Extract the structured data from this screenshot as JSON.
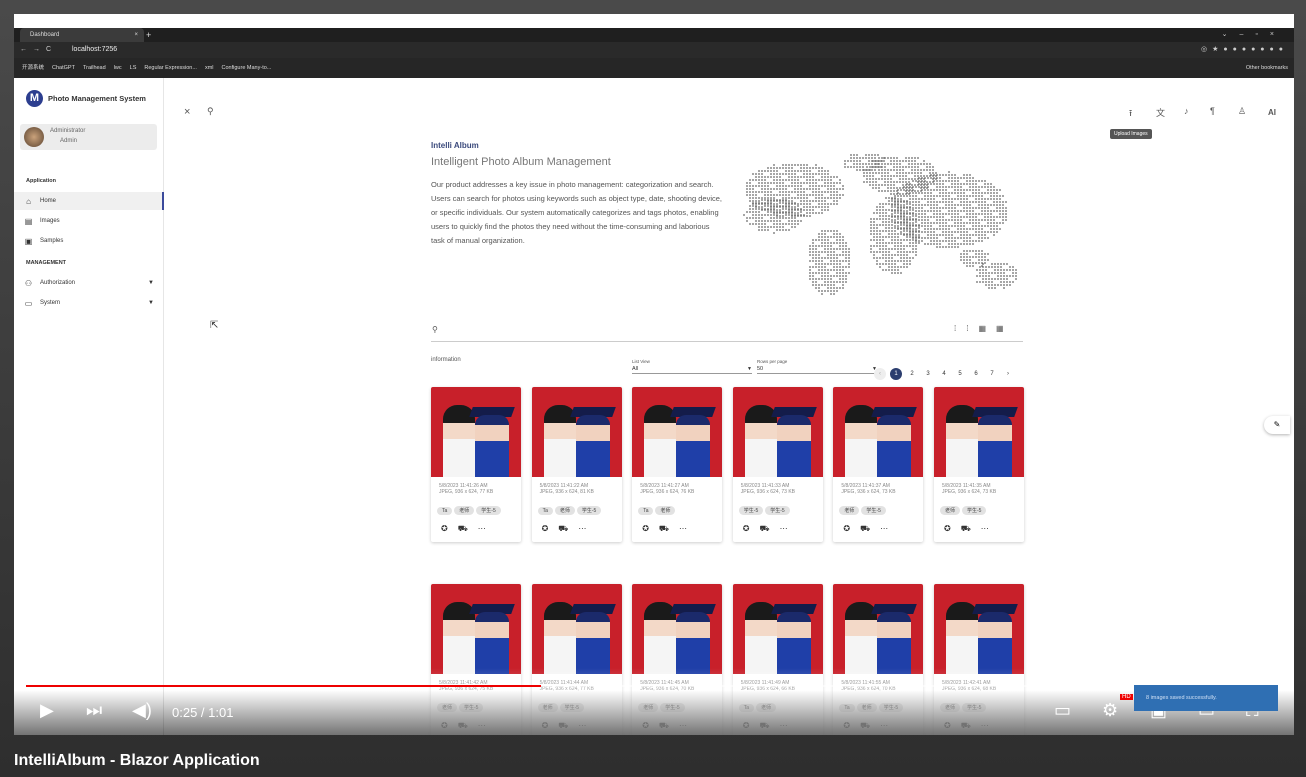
{
  "video": {
    "caption": "IntelliAlbum - Blazor Application",
    "time": "0:25 / 1:01",
    "progress": 0.41,
    "hd_badge": "HD"
  },
  "browser": {
    "tab_title": "Dashboard",
    "url": "localhost:7256",
    "bookmarks": [
      "开源系统",
      "ChatGPT",
      "Trailhead",
      "lwc",
      "LS",
      "Regular Expression...",
      "xml",
      "Configure Many-to...",
      "Other bookmarks"
    ]
  },
  "sidebar": {
    "brand": "Photo Management System",
    "user_name": "Administrator",
    "user_role": "Admin",
    "section_app": "Application",
    "items_app": [
      {
        "label": "Home",
        "icon": "home-icon"
      },
      {
        "label": "Images",
        "icon": "images-icon"
      },
      {
        "label": "Samples",
        "icon": "samples-icon"
      }
    ],
    "section_mgmt": "MANAGEMENT",
    "items_mgmt": [
      {
        "label": "Authorization",
        "icon": "authorization-icon"
      },
      {
        "label": "System",
        "icon": "system-icon"
      }
    ]
  },
  "header": {
    "tooltip": "Upload Images",
    "ai_label": "AI"
  },
  "hero": {
    "title": "Intelli Album",
    "subtitle": "Intelligent Photo Album Management",
    "description": "Our product addresses a key issue in photo management: categorization and search. Users can search for photos using keywords such as object type, date, shooting device, or specific individuals. Our system automatically categorizes and tags photos, enabling users to quickly find the photos they need without the time-consuming and laborious task of manual organization."
  },
  "search": {
    "placeholder": "",
    "info_label": "information",
    "list_view_label": "List View",
    "list_view_value": "All",
    "rows_label": "Rows per page",
    "rows_value": "50",
    "pages": [
      "1",
      "2",
      "3",
      "4",
      "5",
      "6",
      "7"
    ],
    "current_page": "1"
  },
  "cards_row1": [
    {
      "date": "5/8/2023 11:41:26 AM",
      "info": "JPEG, 936 x 624, 77 KB",
      "tags": [
        "Ta",
        "老师",
        "学生-5"
      ]
    },
    {
      "date": "5/8/2023 11:41:22 AM",
      "info": "JPEG, 936 x 624, 81 KB",
      "tags": [
        "Ta",
        "老师",
        "学生-5"
      ]
    },
    {
      "date": "5/8/2023 11:41:27 AM",
      "info": "JPEG, 936 x 624, 76 KB",
      "tags": [
        "Ta",
        "老师"
      ]
    },
    {
      "date": "5/8/2023 11:41:33 AM",
      "info": "JPEG, 936 x 624, 73 KB",
      "tags": [
        "学生-5",
        "学生-5"
      ]
    },
    {
      "date": "5/8/2023 11:41:37 AM",
      "info": "JPEG, 936 x 624, 73 KB",
      "tags": [
        "老师",
        "学生-5"
      ]
    },
    {
      "date": "5/8/2023 11:41:35 AM",
      "info": "JPEG, 936 x 624, 73 KB",
      "tags": [
        "老师",
        "学生-5"
      ]
    }
  ],
  "cards_row2": [
    {
      "date": "5/8/2023 11:41:42 AM",
      "info": "JPEG, 936 x 624, 75 KB",
      "tags": [
        "老师",
        "学生-5"
      ]
    },
    {
      "date": "5/8/2023 11:41:44 AM",
      "info": "JPEG, 936 x 624, 77 KB",
      "tags": [
        "老师",
        "学生-5"
      ]
    },
    {
      "date": "5/8/2023 11:41:45 AM",
      "info": "JPEG, 936 x 624, 70 KB",
      "tags": [
        "老师",
        "学生-5"
      ]
    },
    {
      "date": "5/8/2023 11:41:49 AM",
      "info": "JPEG, 936 x 624, 66 KB",
      "tags": [
        "Ta",
        "老师"
      ]
    },
    {
      "date": "5/8/2023 11:41:55 AM",
      "info": "JPEG, 936 x 624, 70 KB",
      "tags": [
        "Ta",
        "老师",
        "学生-5"
      ]
    },
    {
      "date": "5/8/2023 11:42:41 AM",
      "info": "JPEG, 936 x 624, 68 KB",
      "tags": [
        "老师",
        "学生-5"
      ]
    }
  ],
  "toast": "8 images saved successfully."
}
